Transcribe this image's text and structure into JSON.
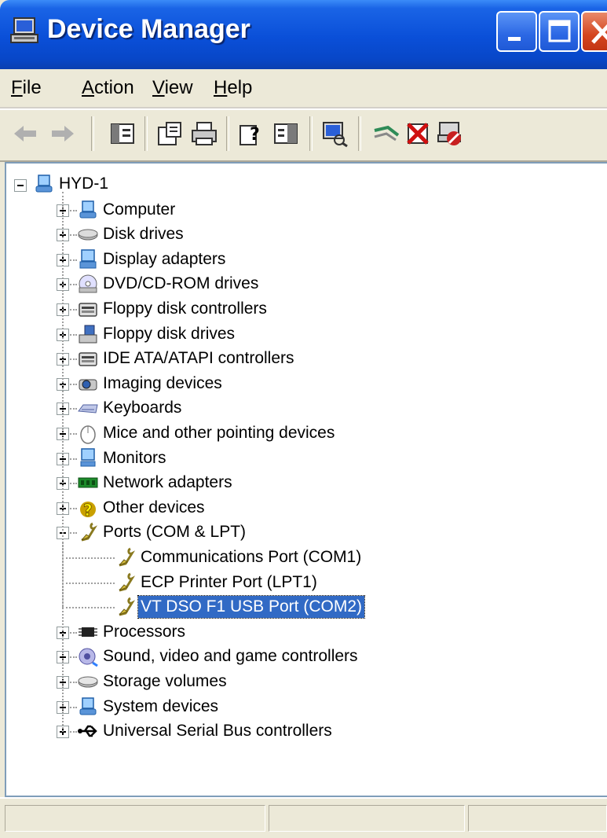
{
  "window": {
    "title": "Device Manager",
    "controls": {
      "minimize": "minimize",
      "maximize": "maximize",
      "close": "close"
    }
  },
  "menu": [
    {
      "pre": "",
      "mn": "F",
      "post": "ile"
    },
    {
      "pre": "",
      "mn": "A",
      "post": "ction"
    },
    {
      "pre": "",
      "mn": "V",
      "post": "iew"
    },
    {
      "pre": "",
      "mn": "H",
      "post": "elp"
    }
  ],
  "toolbar": {
    "buttons": [
      "back-icon",
      "forward-icon",
      "up-level-icon",
      "properties-icon",
      "print-icon",
      "help-icon",
      "view-icon",
      "scan-hardware-icon",
      "update-driver-icon",
      "uninstall-icon",
      "disable-icon"
    ]
  },
  "tree": {
    "root": "HYD-1",
    "categories": [
      {
        "label": "Computer",
        "icon": "computer-icon"
      },
      {
        "label": "Disk drives",
        "icon": "disk-drive-icon"
      },
      {
        "label": "Display adapters",
        "icon": "display-adapter-icon"
      },
      {
        "label": "DVD/CD-ROM drives",
        "icon": "dvd-drive-icon"
      },
      {
        "label": "Floppy disk controllers",
        "icon": "controller-icon"
      },
      {
        "label": "Floppy disk drives",
        "icon": "floppy-drive-icon"
      },
      {
        "label": "IDE ATA/ATAPI controllers",
        "icon": "controller-icon"
      },
      {
        "label": "Imaging devices",
        "icon": "camera-icon"
      },
      {
        "label": "Keyboards",
        "icon": "keyboard-icon"
      },
      {
        "label": "Mice and other pointing devices",
        "icon": "mouse-icon"
      },
      {
        "label": "Monitors",
        "icon": "monitor-icon"
      },
      {
        "label": "Network adapters",
        "icon": "network-card-icon"
      },
      {
        "label": "Other devices",
        "icon": "unknown-device-icon"
      },
      {
        "label": "Ports (COM & LPT)",
        "icon": "port-icon",
        "expanded": true,
        "children": [
          {
            "label": "Communications Port (COM1)",
            "icon": "port-icon"
          },
          {
            "label": "ECP Printer Port (LPT1)",
            "icon": "port-icon"
          },
          {
            "label": "VT DSO F1 USB Port (COM2)",
            "icon": "port-icon",
            "selected": true
          }
        ]
      },
      {
        "label": "Processors",
        "icon": "processor-icon"
      },
      {
        "label": "Sound, video and game controllers",
        "icon": "sound-icon"
      },
      {
        "label": "Storage volumes",
        "icon": "storage-icon"
      },
      {
        "label": "System devices",
        "icon": "system-device-icon"
      },
      {
        "label": "Universal Serial Bus controllers",
        "icon": "usb-icon"
      }
    ]
  },
  "colors": {
    "title_bar": "#0a4fd8",
    "selection": "#316ac5",
    "chrome": "#ece9d8",
    "close_button": "#d4451f"
  }
}
